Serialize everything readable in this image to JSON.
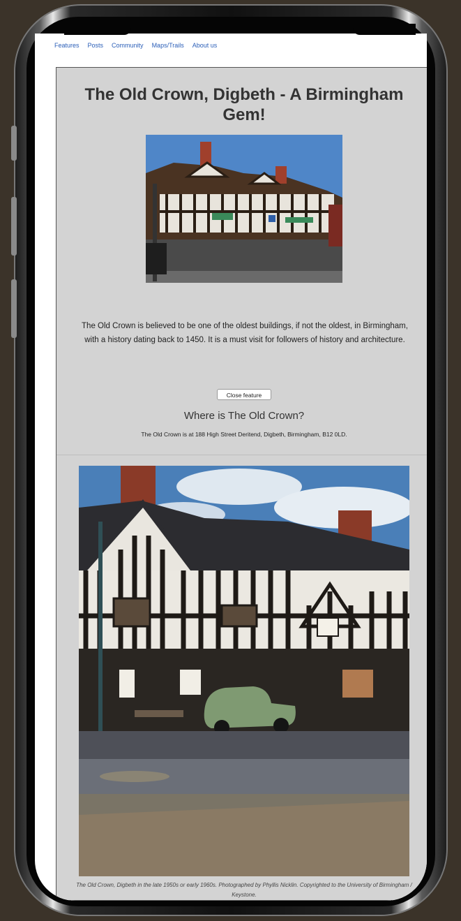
{
  "nav": {
    "items": [
      "Features",
      "Posts",
      "Community",
      "Maps/Trails",
      "About us"
    ]
  },
  "article": {
    "title": "The Old Crown, Digbeth - A Birmingham Gem!",
    "intro": "The Old Crown is believed to be one of the oldest buildings, if not the oldest, in Birmingham, with a history dating back to 1450. It is a must visit for followers of history and architecture.",
    "close_label": "Close feature",
    "where_heading": "Where is The Old Crown?",
    "address": "The Old Crown is at 188 High Street Deritend, Digbeth, Birmingham, B12 0LD.",
    "caption": "The Old Crown, Digbeth in the late 1950s or early 1960s. Photographed by Phyllis Nicklin. Copyrighted to the University of Birmingham / Keystone."
  },
  "colors": {
    "nav_link": "#2b5fb8",
    "article_bg": "#d3d3d3",
    "page_bg": "#3b3329"
  }
}
